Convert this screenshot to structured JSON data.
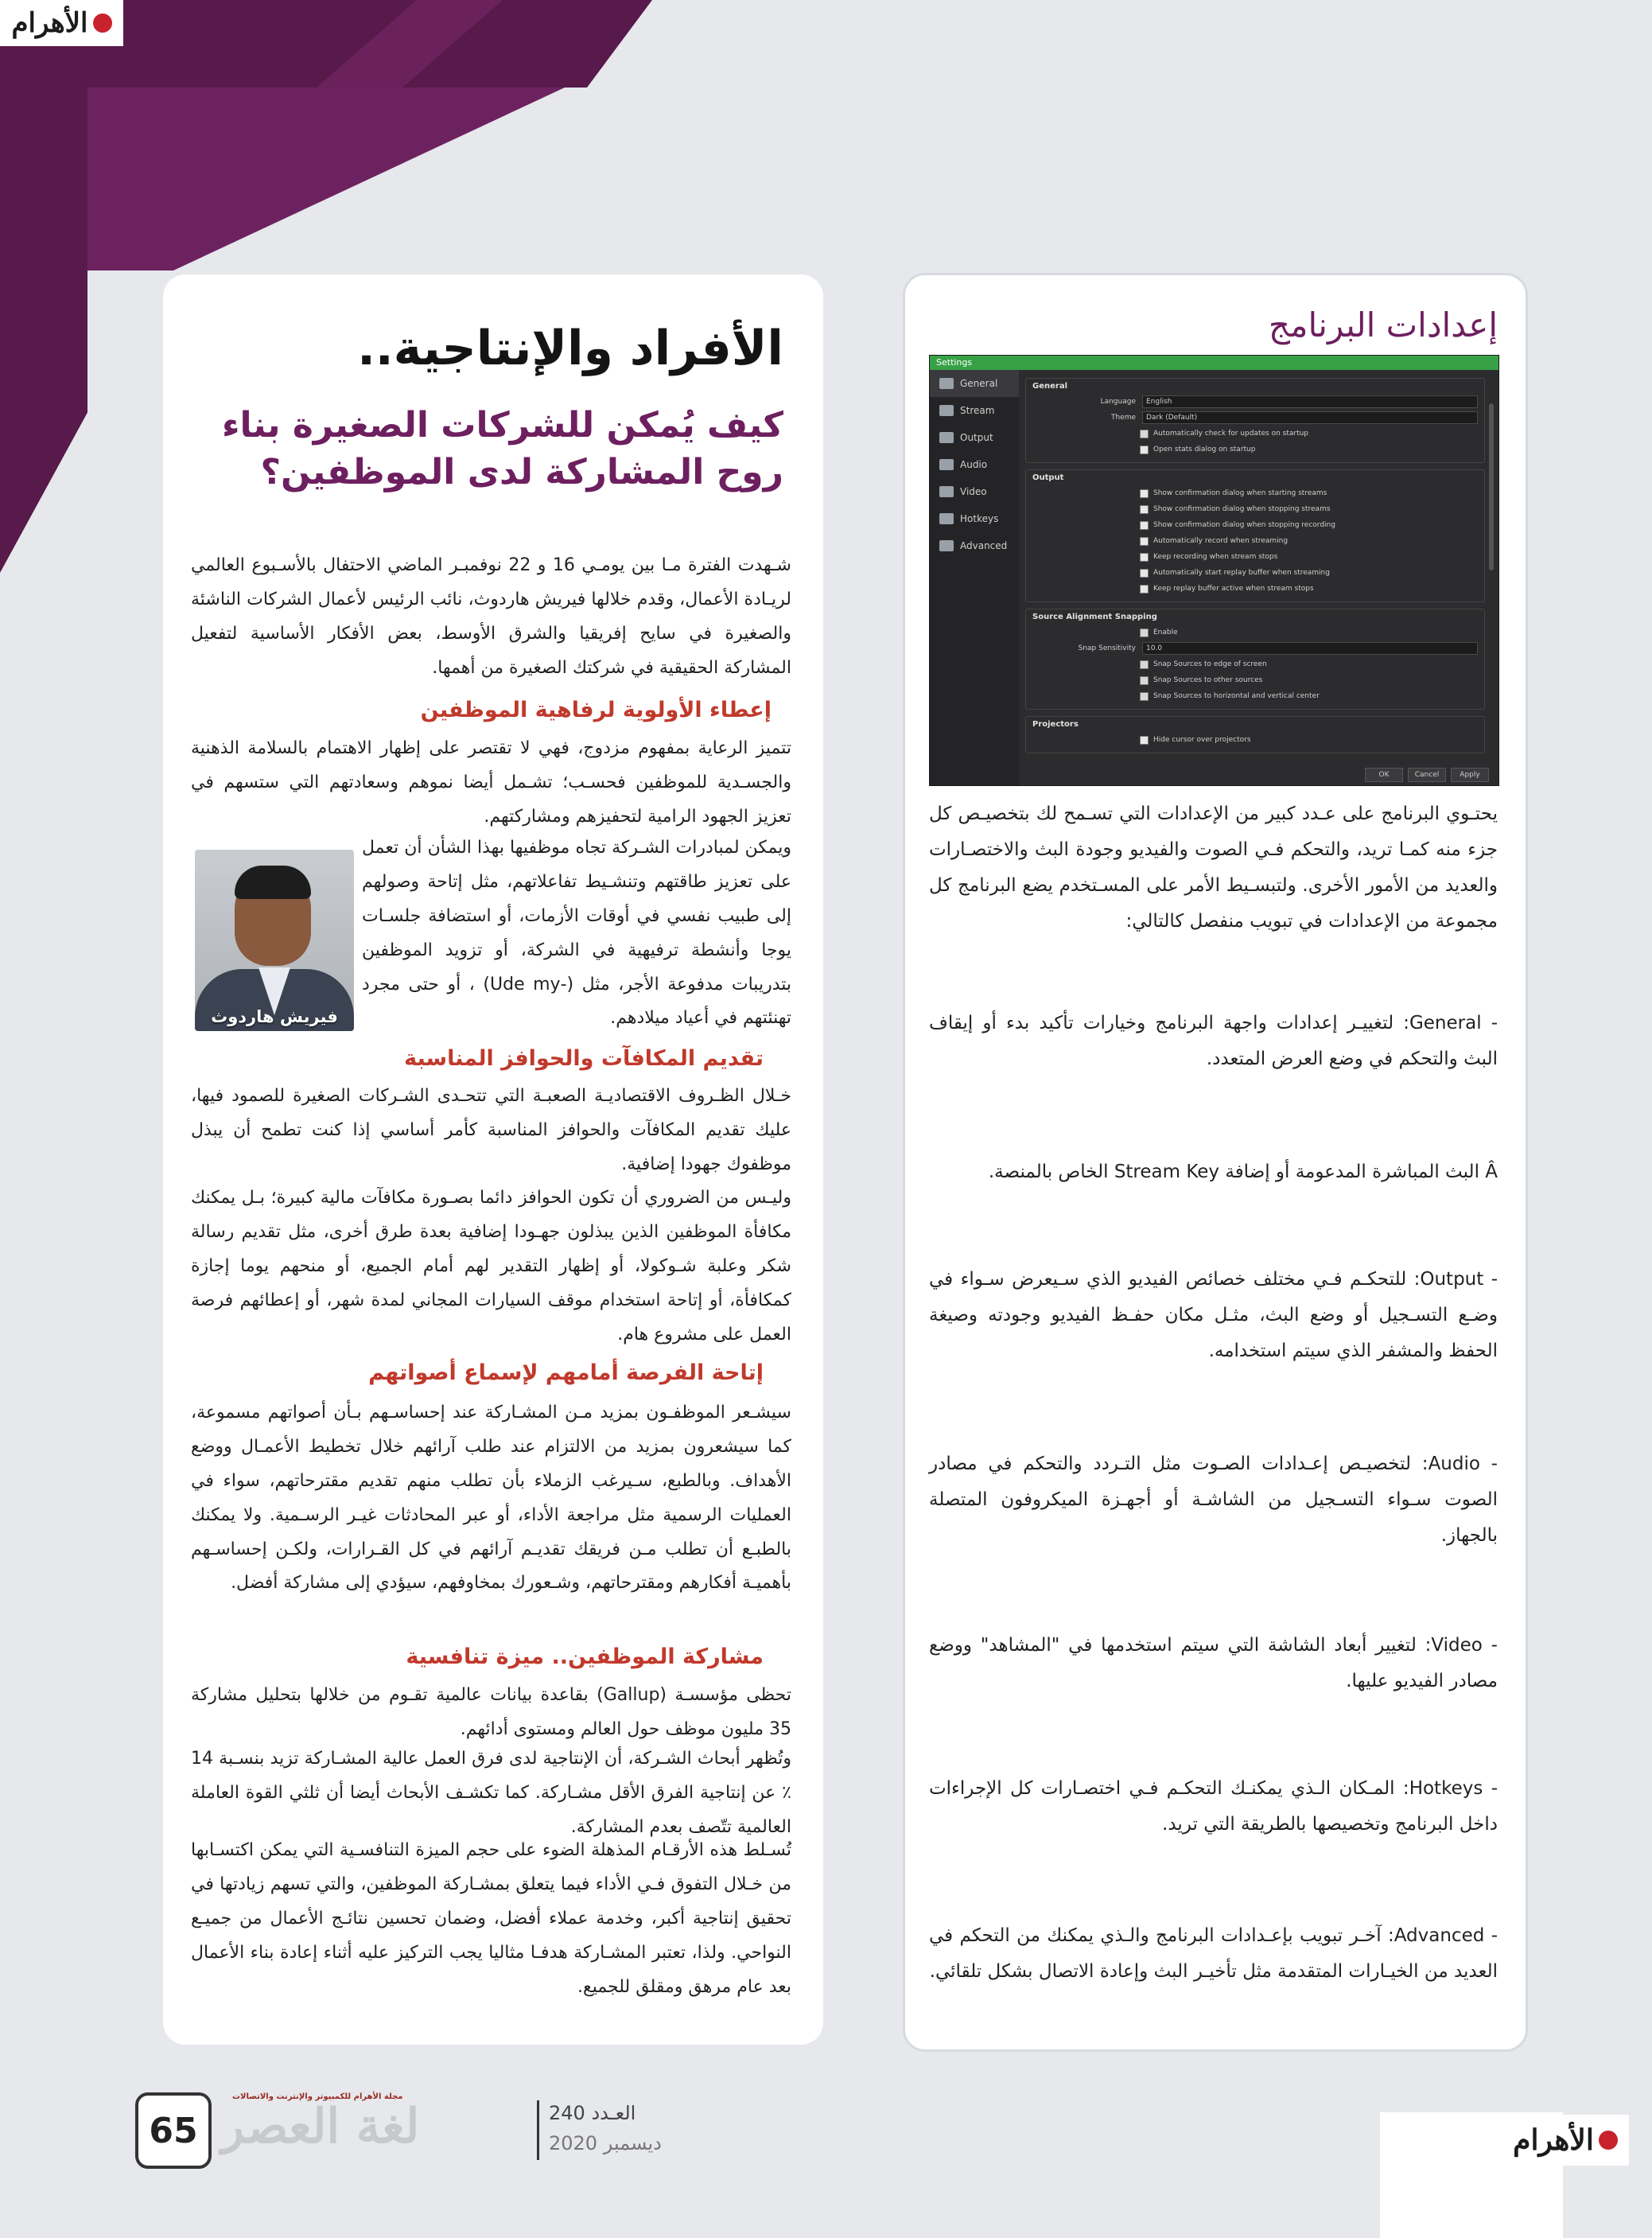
{
  "branding": {
    "logo_top": "الأهرام",
    "logo_bottom": "الأهرام"
  },
  "article": {
    "title": "الأفراد والإنتاجية..",
    "subtitle": "كيف يُمكن للشركات الصغيرة بناء روح المشاركة لدى الموظفين؟",
    "intro": "شـهدت الفترة مـا بين يومـي 16 و 22 نوفمبـر الماضي الاحتفال بالأسـبوع العالمي لريـادة الأعمال، وقدم خلالها فيريش هاردوث، نائب الرئيس لأعمال الشركات الناشئة والصغيرة في سايح إفريقيا والشرق الأوسط، بعض الأفكار الأساسية لتفعيل المشاركة الحقيقية في شركتك الصغيرة من أهمها.",
    "photo_caption": "فيريش هاردوث",
    "sections": [
      {
        "heading": "إعطاء الأولوية لرفاهية الموظفين",
        "paragraphs": [
          "تتميز الرعاية بمفهوم مزدوج، فهي لا تقتصر على إظهار الاهتمام بالسلامة الذهنية والجسـدية للموظفين فحسـب؛ تشـمل أيضا نموهم وسعادتهم التي ستسهم في تعزيز الجهود الرامية لتحفيزهم ومشاركتهم.",
          "ويمكن لمبادرات الشـركة تجاه موظفيها بهذا الشأن أن تعمل على تعزيز طاقتهم وتنشـيط تفاعلاتهم، مثل إتاحة وصولهم إلى طبيب نفسي في أوقات الأزمات، أو استضافة جلسـات يوجا وأنشطة ترفيهية في الشركة، أو تزويد الموظفين بتدريبات مدفوعة الأجر، مثل (-Ude my) ، أو حتى مجرد تهنئتهم في أعياد ميلادهم."
        ]
      },
      {
        "heading": "تقديم المكافآت والحوافز المناسبة",
        "paragraphs": [
          "خـلال الظـروف الاقتصاديـة الصعبـة التي تتحـدى الشـركات الصغيرة للصمود فيها، عليك تقديم المكافآت والحوافز المناسبة كأمر أساسي إذا كنت تطمح أن يبذل موظفوك جهودا إضافية.",
          "وليـس من الضروري أن تكون الحوافز دائما بصـورة مكافآت مالية كبيرة؛ بـل يمكنك مكافأة الموظفين الذين يبذلون جهـودا إضافية بعدة طرق أخرى، مثل تقديم رسالة شكر وعلبة شـوكولا، أو إظهار التقدير لهم أمام الجميع، أو منحهم يوما إجازة كمكافأة، أو إتاحة استخدام موقف السيارات المجاني لمدة شهر، أو إعطائهم فرصة العمل على مشروع هام."
        ]
      },
      {
        "heading": "إتاحة الفرصة أمامهم لإسماع أصواتهم",
        "paragraphs": [
          "سيشـعر الموظفـون بمزيد مـن المشـاركة عند إحساسـهم بـأن أصواتهم مسموعة، كما سيشعرون بمزيد من الالتزام عند طلب آرائهم خلال تخطيط الأعمـال ووضع الأهداف. وبالطبع، سـيرغب الزملاء بأن تطلب منهم تقديم مقترحاتهم، سواء في العمليات الرسمية مثل مراجعة الأداء، أو عبر المحادثات غيـر الرسـمية. ولا يمكنك بالطبـع أن تطلب مـن فريقك تقديـم آرائهم في كل القـرارات، ولكـن إحساسـهم بأهميـة أفكارهم ومقترحاتهم، وشـعورك بمخاوفهم، سيؤدي إلى مشاركة أفضل."
        ]
      },
      {
        "heading": "مشاركة الموظفين.. ميزة تنافسية",
        "paragraphs": [
          "تحظى مؤسسـة (Gallup) بقاعدة بيانات عالمية تقـوم من خلالها بتحليل مشاركة 35 مليون موظف حول العالم ومستوى أدائهم.",
          "وتُظهر أبحاث الشـركة، أن الإنتاجية لدى فرق العمل عالية المشـاركة تزيد بنسـبة 14 ٪ عن إنتاجية الفرق الأقل مشـاركة. كما تكشـف الأبحاث أيضا أن ثلثي القوة العاملة العالمية تتّصف بعدم المشاركة.",
          "تُسـلط هذه الأرقـام المذهلة الضوء على حجم الميزة التنافسـية التي يمكن اكتسـابها من خـلال التفوق فـي الأداء فيما يتعلق بمشـاركة الموظفين، والتي تسهم زيادتها في تحقيق إنتاجية أكبر، وخدمة عملاء أفضل، وضمان تحسين نتائـج الأعمال من جميـع النواحي. ولذا، تعتبر المشـاركة هدفـا مثاليا يجب التركيز عليه أثناء إعادة بناء الأعمال بعد عام مرهق ومقلق للجميع."
        ]
      }
    ]
  },
  "program_settings": {
    "title": "إعدادات البرنامج",
    "intro": "يحتـوي البرنامج على عـدد كبير من الإعدادات التي تسـمح لك بتخصيـص كل جزء منه كمـا تريد، والتحكم فـي الصوت والفيديو وجودة البث والاختصـارات والعديد من الأمور الأخرى. ولتبسـيط الأمر على المسـتخدم يضع البرنامج كل مجموعة من الإعدادات في تبويب منفصل كالتالي:",
    "items": [
      "- General: لتغييـر إعدادات واجهة البرنامج وخيارات تأكيد بدء أو إيقاف البث والتحكم في وضع العرض المتعدد.",
      "Â البث المباشرة المدعومة أو إضافة Stream Key الخاص بالمنصة.",
      "- Output: للتحكـم فـي مختلف خصائص الفيديو الذي سـيعرض سـواء في وضـع التسـجيل أو وضع البث، مثـل مكان حفـظ الفيديو وجودته وصيغة الحفظ والمشفر الذي سيتم استخدامه.",
      "- Audio: لتخصيـص إعـدادات الصـوت مثل التـردد والتحكم في مصادر الصوت سـواء التسـجيل من الشاشـة أو أجهـزة الميكروفون المتصلة بالجهاز.",
      "- Video: لتغيير أبعاد الشاشة التي سيتم استخدمها في \"المشاهد\" ووضع مصادر الفيديو عليها.",
      "- Hotkeys: المـكان الـذي يمكنـك التحكـم فـي اختصـارات كل الإجراءات داخل البرنامج وتخصيصها بالطريقة التي تريد.",
      "- Advanced: آخـر تبويب بإعـدادات البرنامج والـذي يمكنك من التحكم في العديد من الخيـارات المتقدمة مثل تأخيـر البث وإعادة الاتصال بشكل تلقائي."
    ]
  },
  "screenshot": {
    "window_title": "Settings",
    "sidebar": [
      "General",
      "Stream",
      "Output",
      "Audio",
      "Video",
      "Hotkeys",
      "Advanced"
    ],
    "general": {
      "group": "General",
      "language_label": "Language",
      "language_value": "English",
      "theme_label": "Theme",
      "theme_value": "Dark (Default)",
      "checks": [
        "Automatically check for updates on startup",
        "Open stats dialog on startup"
      ]
    },
    "output": {
      "group": "Output",
      "checks": [
        "Show confirmation dialog when starting streams",
        "Show confirmation dialog when stopping streams",
        "Show confirmation dialog when stopping recording",
        "Automatically record when streaming",
        "Keep recording when stream stops",
        "Automatically start replay buffer when streaming",
        "Keep replay buffer active when stream stops"
      ]
    },
    "snapping": {
      "group": "Source Alignment Snapping",
      "enable": "Enable",
      "sensitivity_label": "Snap Sensitivity",
      "sensitivity_value": "10.0",
      "checks": [
        "Snap Sources to edge of screen",
        "Snap Sources to other sources",
        "Snap Sources to horizontal and vertical center"
      ]
    },
    "projectors": {
      "group": "Projectors",
      "check": "Hide cursor over projectors"
    },
    "buttons": [
      "OK",
      "Cancel",
      "Apply"
    ]
  },
  "footer": {
    "page_number": "65",
    "magazine": "لغة العصر",
    "tagline": "مجلة الأهرام للكمبيوتر والإنترنت والاتصالات",
    "issue_label": "العـدد 240",
    "issue_date": "ديسمبر 2020"
  }
}
